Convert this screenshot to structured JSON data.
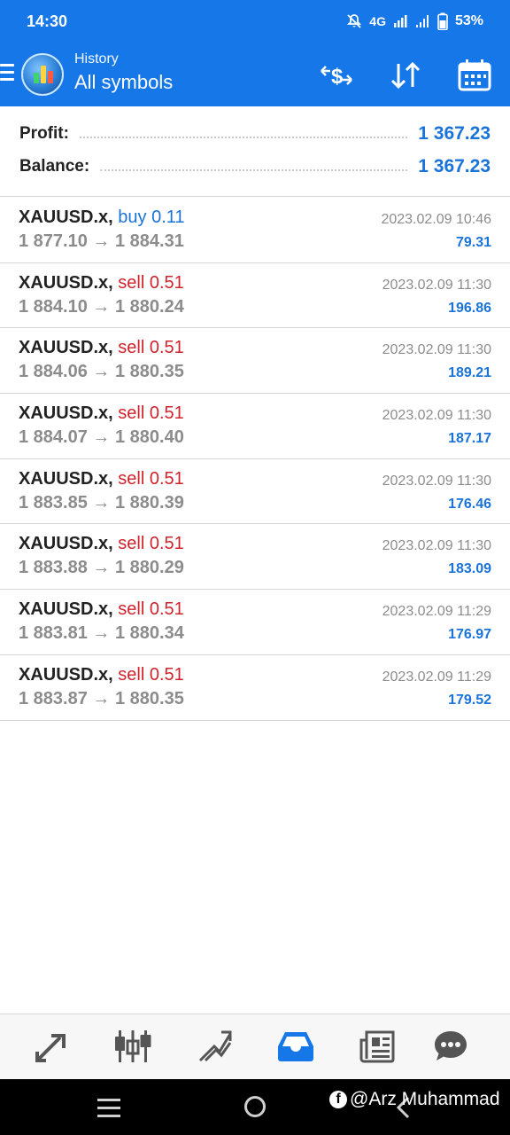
{
  "status_bar": {
    "time": "14:30",
    "network": "4G",
    "battery": "53%"
  },
  "header": {
    "subtitle": "History",
    "title": "All symbols",
    "actions": [
      "currency-exchange-icon",
      "sort-icon",
      "calendar-icon"
    ]
  },
  "summary": {
    "profit_label": "Profit:",
    "profit_value": "1 367.23",
    "balance_label": "Balance:",
    "balance_value": "1 367.23"
  },
  "deals": [
    {
      "symbol": "XAUUSD.x,",
      "side": "buy",
      "side_text": "buy 0.11",
      "prices": "1 877.10 → 1 884.31",
      "time": "2023.02.09 10:46",
      "profit": "79.31"
    },
    {
      "symbol": "XAUUSD.x,",
      "side": "sell",
      "side_text": "sell 0.51",
      "prices": "1 884.10 → 1 880.24",
      "time": "2023.02.09 11:30",
      "profit": "196.86"
    },
    {
      "symbol": "XAUUSD.x,",
      "side": "sell",
      "side_text": "sell 0.51",
      "prices": "1 884.06 → 1 880.35",
      "time": "2023.02.09 11:30",
      "profit": "189.21"
    },
    {
      "symbol": "XAUUSD.x,",
      "side": "sell",
      "side_text": "sell 0.51",
      "prices": "1 884.07 → 1 880.40",
      "time": "2023.02.09 11:30",
      "profit": "187.17"
    },
    {
      "symbol": "XAUUSD.x,",
      "side": "sell",
      "side_text": "sell 0.51",
      "prices": "1 883.85 → 1 880.39",
      "time": "2023.02.09 11:30",
      "profit": "176.46"
    },
    {
      "symbol": "XAUUSD.x,",
      "side": "sell",
      "side_text": "sell 0.51",
      "prices": "1 883.88 → 1 880.29",
      "time": "2023.02.09 11:30",
      "profit": "183.09"
    },
    {
      "symbol": "XAUUSD.x,",
      "side": "sell",
      "side_text": "sell 0.51",
      "prices": "1 883.81 → 1 880.34",
      "time": "2023.02.09 11:29",
      "profit": "176.97"
    },
    {
      "symbol": "XAUUSD.x,",
      "side": "sell",
      "side_text": "sell 0.51",
      "prices": "1 883.87 → 1 880.35",
      "time": "2023.02.09 11:29",
      "profit": "179.52"
    }
  ],
  "bottom_nav": {
    "items": [
      "quotes-icon",
      "chart-icon",
      "trade-icon",
      "history-icon",
      "news-icon",
      "messages-icon"
    ],
    "active": "history-icon"
  },
  "watermark": {
    "text": "@Arz Muhammad",
    "icon": "facebook-icon"
  },
  "colors": {
    "primary": "#1677e8",
    "buy": "#1a73d9",
    "sell": "#d0232c",
    "muted": "#8c8c8c"
  }
}
